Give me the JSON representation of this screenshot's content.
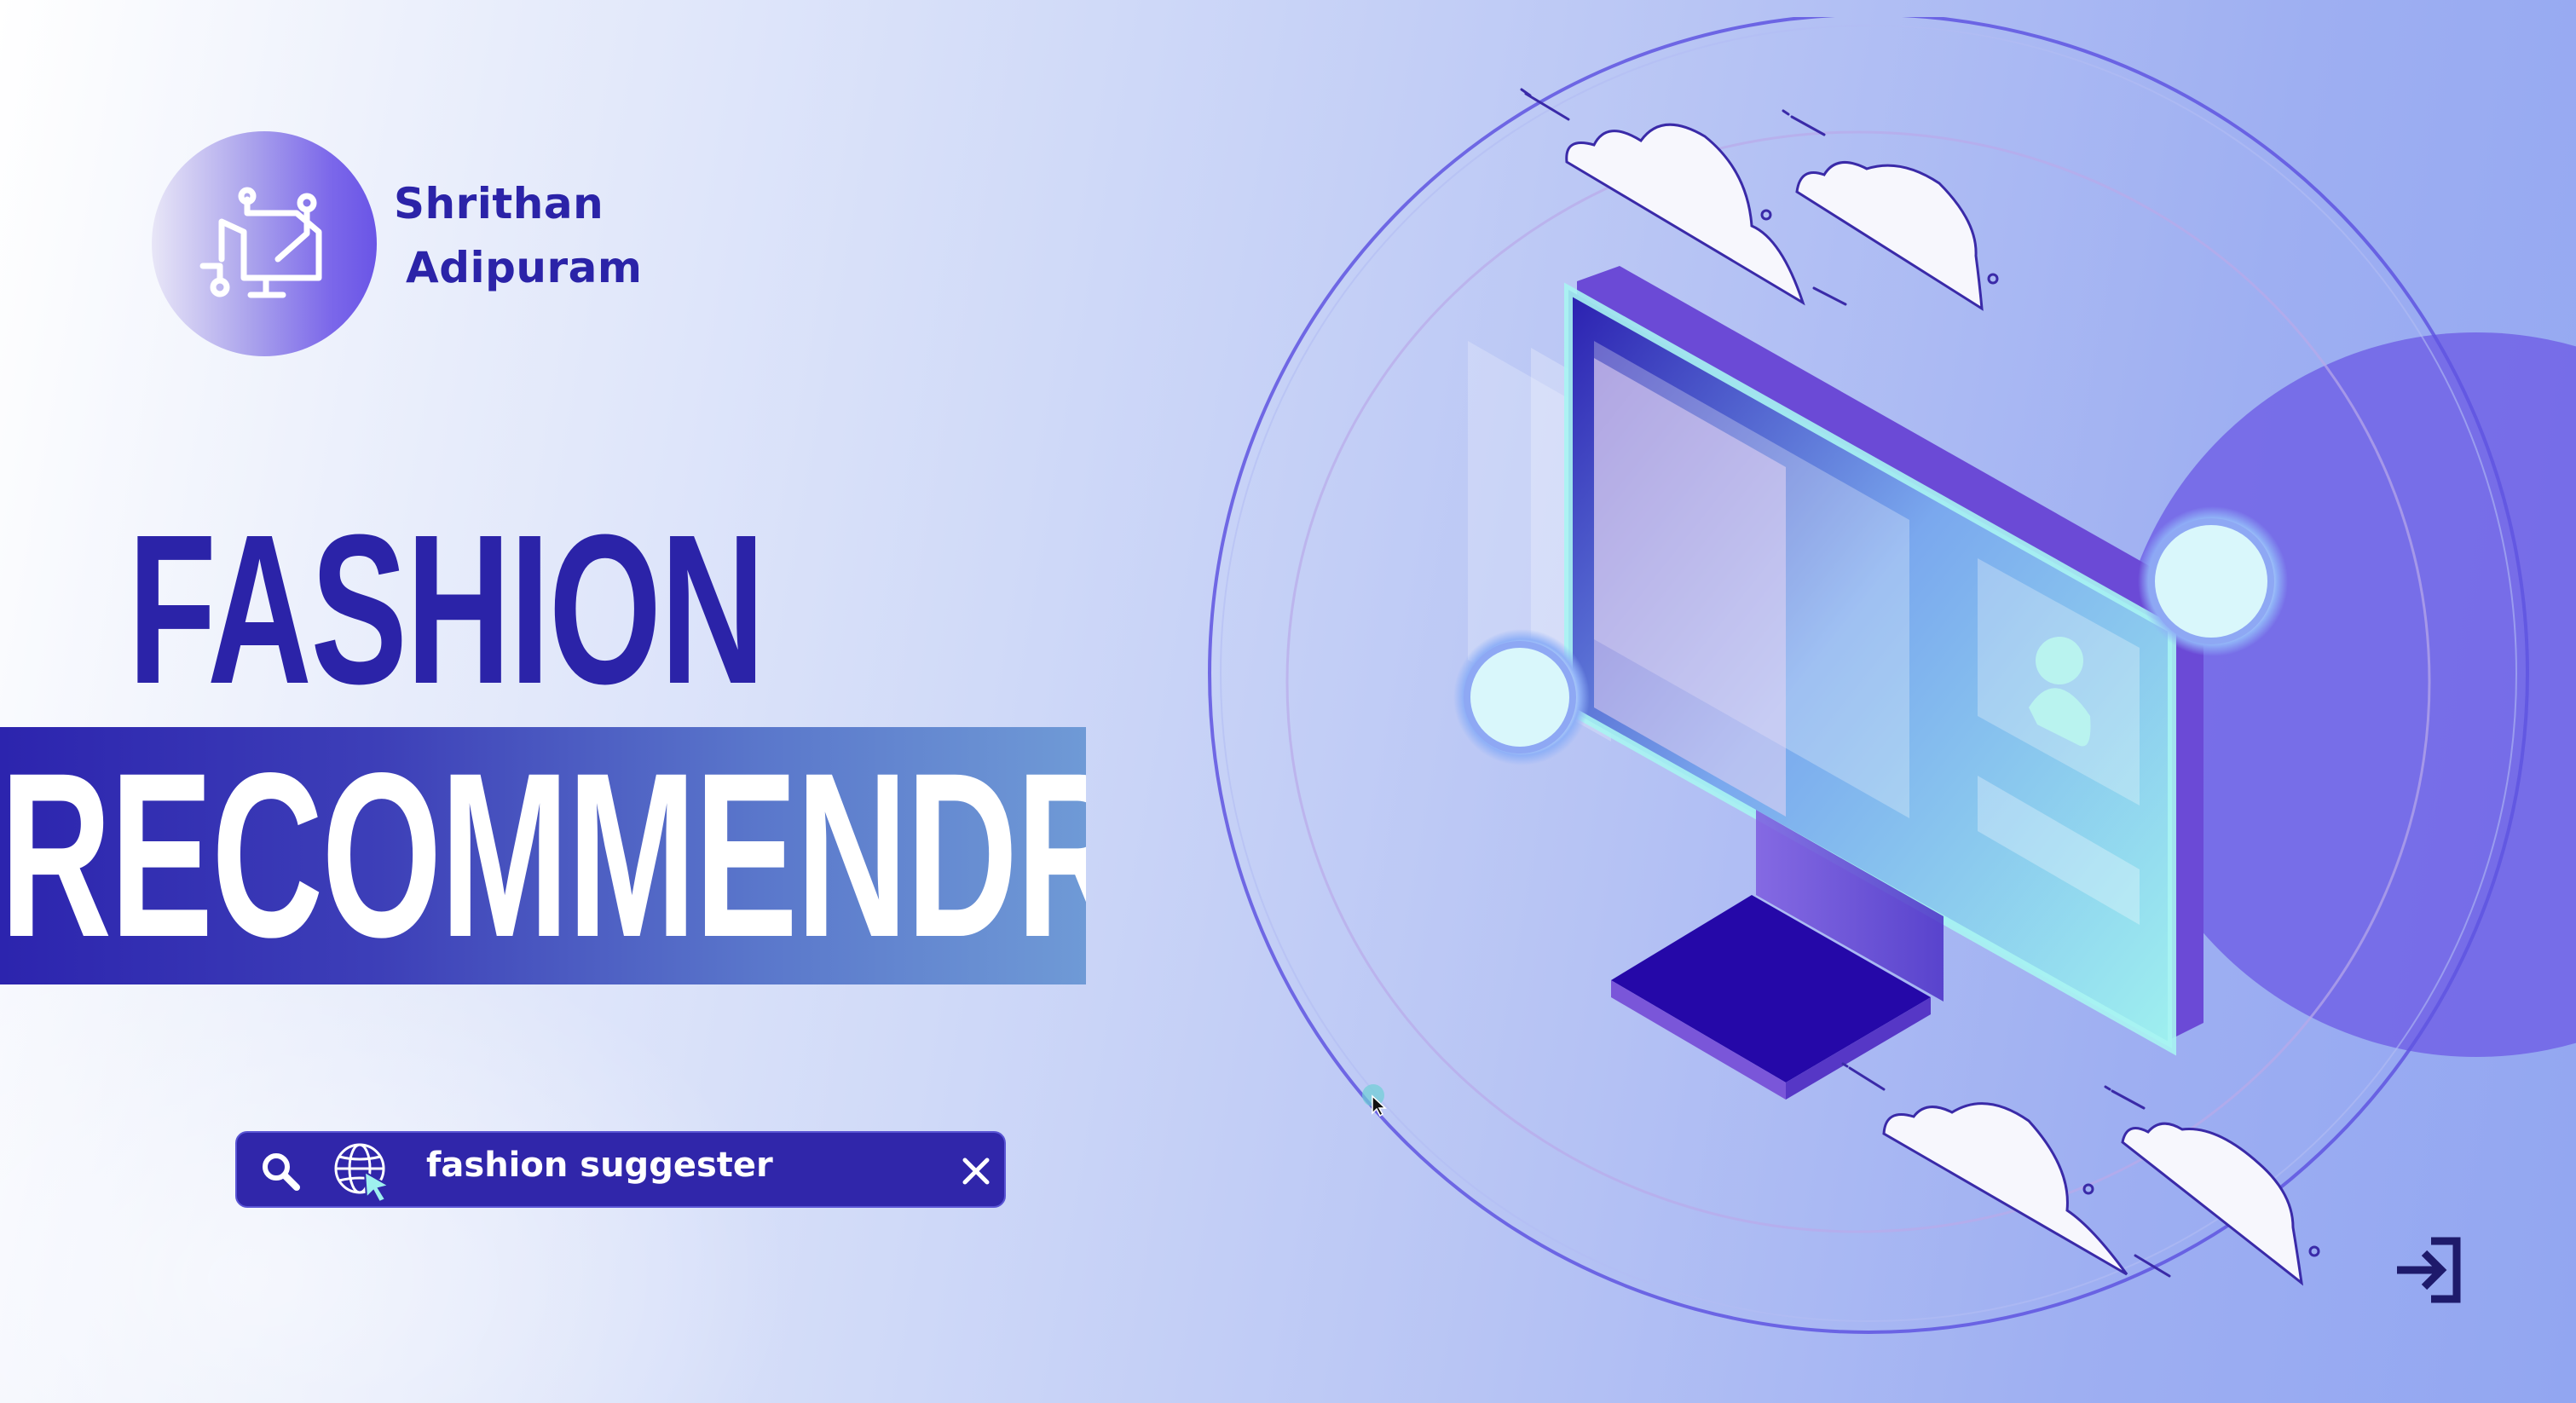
{
  "brand": {
    "name_line1": "Shrithan",
    "name_line2": "Adipuram",
    "logo_icon": "monitor-icon"
  },
  "headline": {
    "line1": "FASHION",
    "line2": "RECOMMENDR"
  },
  "search": {
    "value": "fashion suggester",
    "search_icon": "search-icon",
    "web_icon": "globe-cursor-icon",
    "clear_icon": "close-icon"
  },
  "controls": {
    "exit_icon": "exit-icon"
  },
  "colors": {
    "primary": "#2b23a8",
    "banner_start": "#2c24ae",
    "banner_end": "#6f9ad6",
    "accent_cyan": "#9ef0ef"
  }
}
